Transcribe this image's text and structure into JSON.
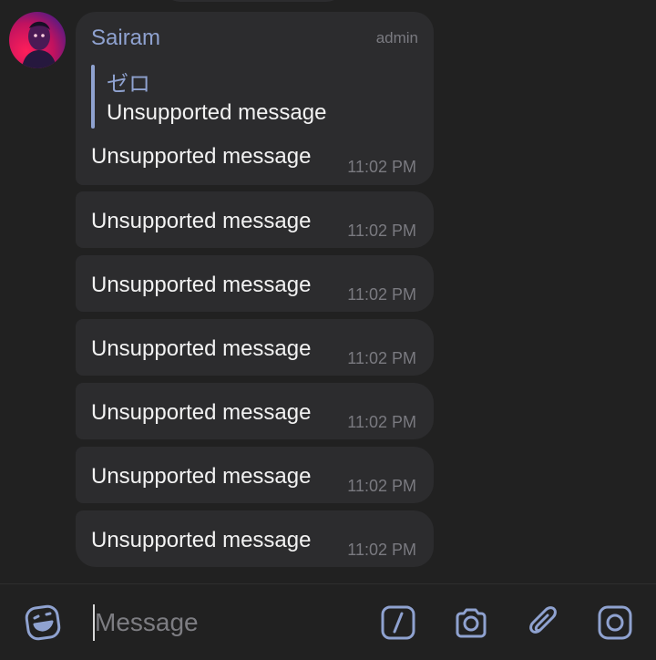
{
  "header_message": {
    "sender": "Sairam",
    "role": "admin",
    "reply": {
      "author": "ゼロ",
      "text": "Unsupported message"
    },
    "text": "Unsupported message",
    "time": "11:02 PM"
  },
  "messages": [
    {
      "text": "Unsupported message",
      "time": "11:02 PM"
    },
    {
      "text": "Unsupported message",
      "time": "11:02 PM"
    },
    {
      "text": "Unsupported message",
      "time": "11:02 PM"
    },
    {
      "text": "Unsupported message",
      "time": "11:02 PM"
    },
    {
      "text": "Unsupported message",
      "time": "11:02 PM"
    },
    {
      "text": "Unsupported message",
      "time": "11:02 PM"
    }
  ],
  "composer": {
    "placeholder": "Message",
    "icons": [
      "emoji-icon",
      "slash-command-icon",
      "camera-icon",
      "attach-icon",
      "instagram-icon"
    ]
  },
  "colors": {
    "background": "#212121",
    "bubble": "#2c2c2e",
    "accent": "#8fa2d0",
    "muted": "#7a7a80",
    "text": "#f2f2f2"
  }
}
